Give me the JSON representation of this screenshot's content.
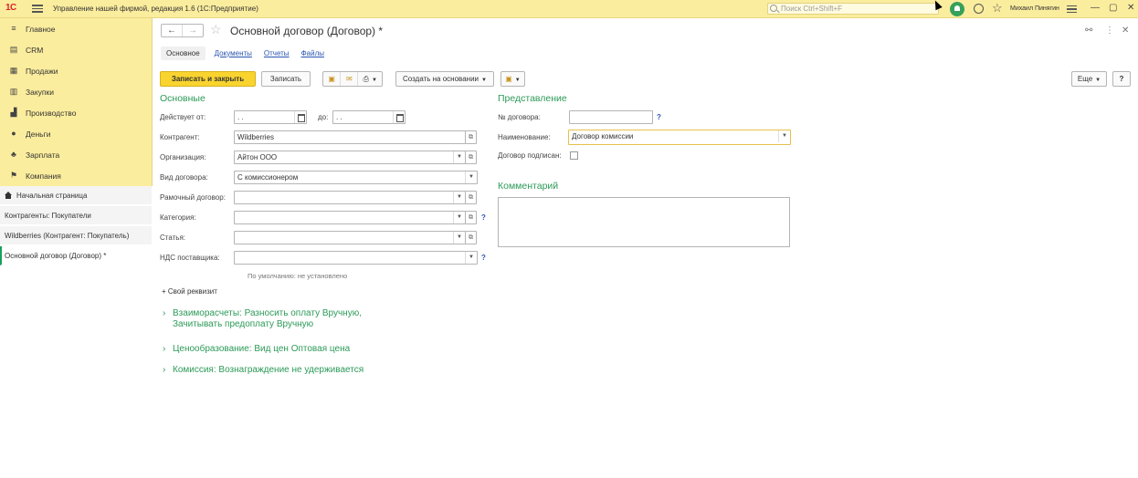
{
  "app": {
    "logo": "1С",
    "title": "Управление нашей фирмой, редакция 1.6  (1С:Предприятие)",
    "search_placeholder": "Поиск Ctrl+Shift+F",
    "user": "Михаил Пинягин"
  },
  "sidebar": {
    "items": [
      {
        "label": "Главное",
        "icon": "menu-icon"
      },
      {
        "label": "CRM",
        "icon": "crm-icon"
      },
      {
        "label": "Продажи",
        "icon": "sales-icon"
      },
      {
        "label": "Закупки",
        "icon": "purchases-icon"
      },
      {
        "label": "Производство",
        "icon": "production-icon"
      },
      {
        "label": "Деньги",
        "icon": "money-icon"
      },
      {
        "label": "Зарплата",
        "icon": "salary-icon"
      },
      {
        "label": "Компания",
        "icon": "company-icon"
      }
    ],
    "open_windows": [
      {
        "label": "Начальная страница",
        "icon": "home-icon"
      },
      {
        "label": "Контрагенты: Покупатели"
      },
      {
        "label": "Wildberries (Контрагент: Покупатель)"
      },
      {
        "label": "Основной договор (Договор) *",
        "active": true
      }
    ]
  },
  "form": {
    "title": "Основной договор (Договор) *",
    "tabs": [
      "Основное",
      "Документы",
      "Отчеты",
      "Файлы"
    ],
    "toolbar": {
      "save_close": "Записать и закрыть",
      "save": "Записать",
      "create_based_on": "Создать на основании",
      "more": "Еще",
      "help": "?"
    },
    "basic": {
      "section_title": "Основные",
      "valid_from_label": "Действует от:",
      "valid_from_value": " .  .",
      "valid_to_label": "до:",
      "valid_to_value": " .  .",
      "counterparty_label": "Контрагент:",
      "counterparty_value": "Wildberries",
      "organization_label": "Организация:",
      "organization_value": "Айтон ООО",
      "contract_type_label": "Вид договора:",
      "contract_type_value": "С комиссионером",
      "frame_contract_label": "Рамочный договор:",
      "frame_contract_value": "",
      "category_label": "Категория:",
      "category_value": "",
      "article_label": "Статья:",
      "article_value": "",
      "vat_label": "НДС поставщика:",
      "vat_value": "",
      "vat_hint": "По умолчанию: не установлено",
      "own_attribute": "+ Свой реквизит"
    },
    "presentation": {
      "section_title": "Представление",
      "number_label": "№ договора:",
      "number_value": "",
      "name_label": "Наименование:",
      "name_value": "Договор комиссии",
      "signed_label": "Договор подписан:",
      "signed": false
    },
    "comment": {
      "section_title": "Комментарий",
      "value": ""
    },
    "expanders": [
      {
        "line1": "Взаиморасчеты: Разносить оплату Вручную,",
        "line2": "Зачитывать предоплату Вручную"
      },
      {
        "line1": "Ценообразование: Вид цен Оптовая цена",
        "line2": ""
      },
      {
        "line1": "Комиссия: Вознаграждение не удерживается",
        "line2": ""
      }
    ]
  },
  "colors": {
    "accent_yellow": "#fbed9e",
    "primary_button": "#f9d42f",
    "section_green": "#2c9a58",
    "link_blue": "#2a56b0"
  }
}
